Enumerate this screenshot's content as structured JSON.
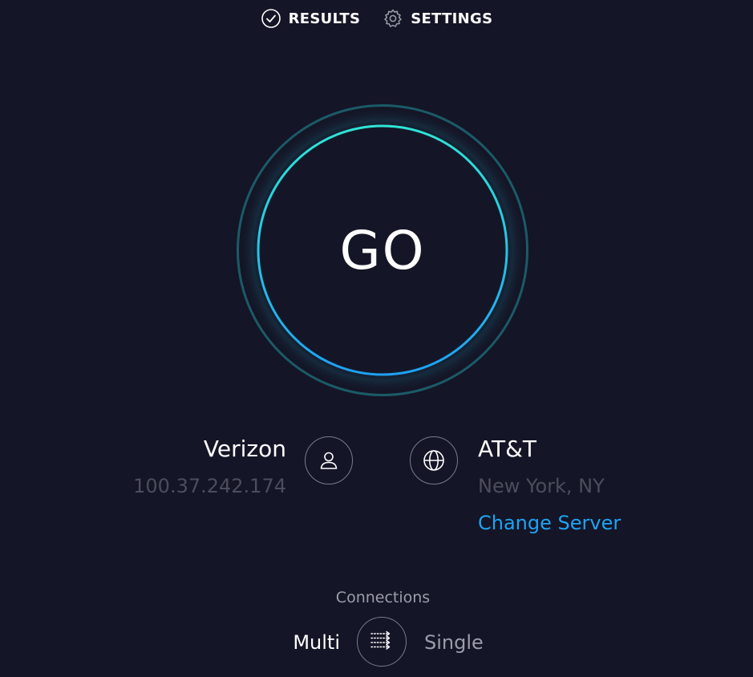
{
  "nav": {
    "results_label": "RESULTS",
    "results_icon": "check-circle-icon",
    "settings_label": "SETTINGS",
    "settings_icon": "gear-icon"
  },
  "test": {
    "go_label": "GO"
  },
  "isp": {
    "name": "Verizon",
    "ip": "100.37.242.174",
    "icon": "user-icon"
  },
  "server": {
    "name": "AT&T",
    "location": "New York, NY",
    "change_label": "Change Server",
    "icon": "globe-icon"
  },
  "connections": {
    "title": "Connections",
    "multi_label": "Multi",
    "single_label": "Single",
    "selected": "Multi",
    "icon": "connections-toggle-icon"
  },
  "colors": {
    "background": "#141526",
    "accent": "#1fa3f3",
    "ring_inner_start": "#2ee6d6",
    "ring_inner_end": "#1ea1f2",
    "ring_outer": "#1b5a68",
    "muted_text": "#4c4d5c"
  }
}
